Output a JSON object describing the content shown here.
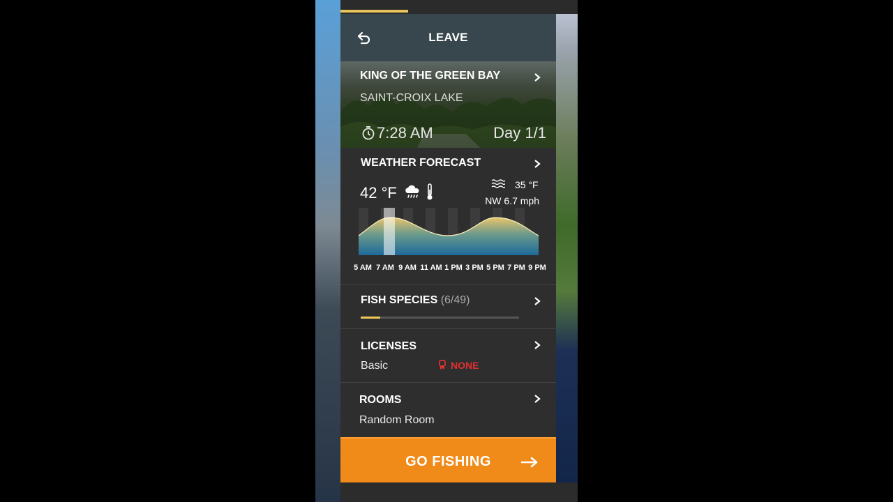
{
  "header": {
    "title": "LEAVE",
    "back_icon": "back-arrow-icon"
  },
  "event": {
    "name": "KING OF THE GREEN BAY",
    "lake": "SAINT-CROIX LAKE",
    "time": "7:28 AM",
    "day": "Day 1/1"
  },
  "weather": {
    "title": "WEATHER FORECAST",
    "air_temp": "42 °F",
    "condition_icon": "rain-cloud-icon",
    "water_temp": "35 °F",
    "wind": "NW 6.7 mph",
    "times": [
      "5 AM",
      "7 AM",
      "9 AM",
      "11 AM",
      "1 PM",
      "3 PM",
      "5 PM",
      "7 PM",
      "9 PM"
    ],
    "current_time_index": 1
  },
  "species": {
    "title": "FISH SPECIES",
    "count": "(6/49)",
    "progress": 0.122
  },
  "licenses": {
    "title": "LICENSES",
    "value": "Basic",
    "status": "NONE"
  },
  "rooms": {
    "title": "ROOMS",
    "value": "Random Room"
  },
  "action": {
    "label": "GO FISHING"
  },
  "colors": {
    "accent": "#f08a18",
    "progress": "#e8c55a",
    "alert": "#e03030",
    "header": "#38474d"
  }
}
